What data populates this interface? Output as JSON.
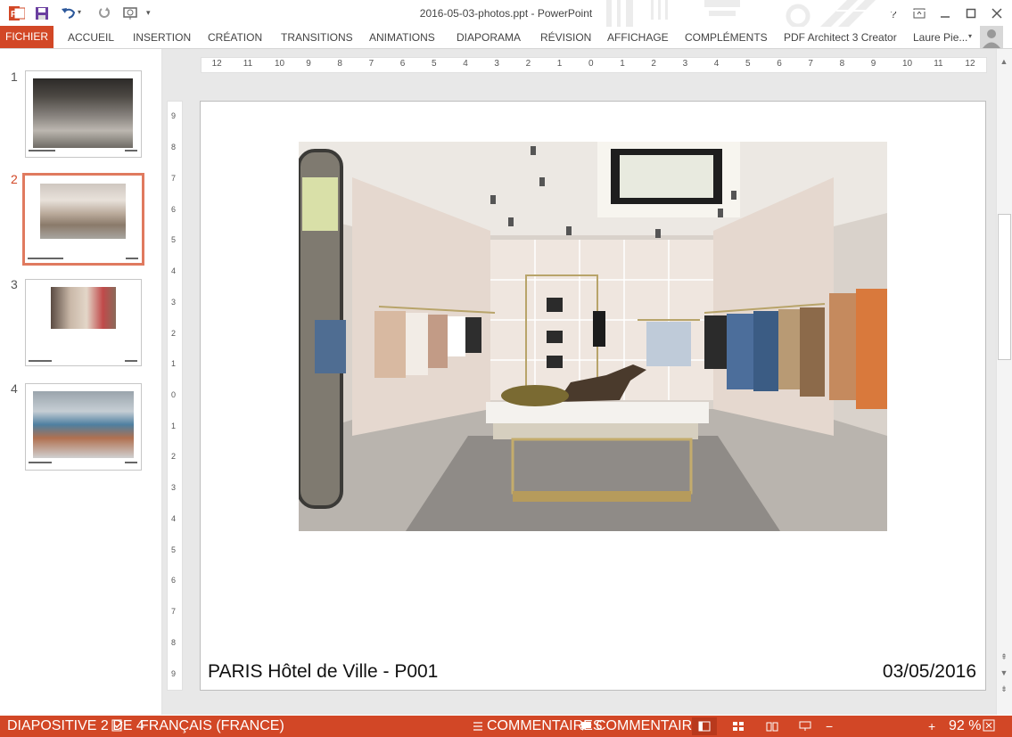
{
  "window": {
    "title": "2016-05-03-photos.ppt - PowerPoint",
    "user_name": "Laure Pie...",
    "help_label": "?"
  },
  "ribbon": {
    "file_tab": "FICHIER",
    "tabs": [
      "ACCUEIL",
      "INSERTION",
      "CRÉATION",
      "TRANSITIONS",
      "ANIMATIONS",
      "DIAPORAMA",
      "RÉVISION",
      "AFFICHAGE",
      "COMPLÉMENTS",
      "PDF Architect 3 Creator"
    ]
  },
  "thumbnails": [
    {
      "number": "1",
      "selected": false
    },
    {
      "number": "2",
      "selected": true
    },
    {
      "number": "3",
      "selected": false
    },
    {
      "number": "4",
      "selected": false
    }
  ],
  "rulers": {
    "horizontal_ticks": [
      "12",
      "11",
      "10",
      "9",
      "8",
      "7",
      "6",
      "5",
      "4",
      "3",
      "2",
      "1",
      "0",
      "1",
      "2",
      "3",
      "4",
      "5",
      "6",
      "7",
      "8",
      "9",
      "10",
      "11",
      "12"
    ],
    "vertical_ticks": [
      "9",
      "8",
      "7",
      "6",
      "5",
      "4",
      "3",
      "2",
      "1",
      "0",
      "1",
      "2",
      "3",
      "4",
      "5",
      "6",
      "7",
      "8",
      "9"
    ]
  },
  "slide": {
    "caption": "PARIS Hôtel de Ville - P001",
    "date": "03/05/2016"
  },
  "status": {
    "slide_indicator": "DIAPOSITIVE 2 DE 4",
    "language": "FRANÇAIS (FRANCE)",
    "notes_label": "COMMENTAIRES",
    "comments_label": "COMMENTAIRES",
    "zoom_value": "92 %"
  },
  "colors": {
    "accent": "#d24726",
    "thumbnail_selected_border": "#e07a5f"
  }
}
